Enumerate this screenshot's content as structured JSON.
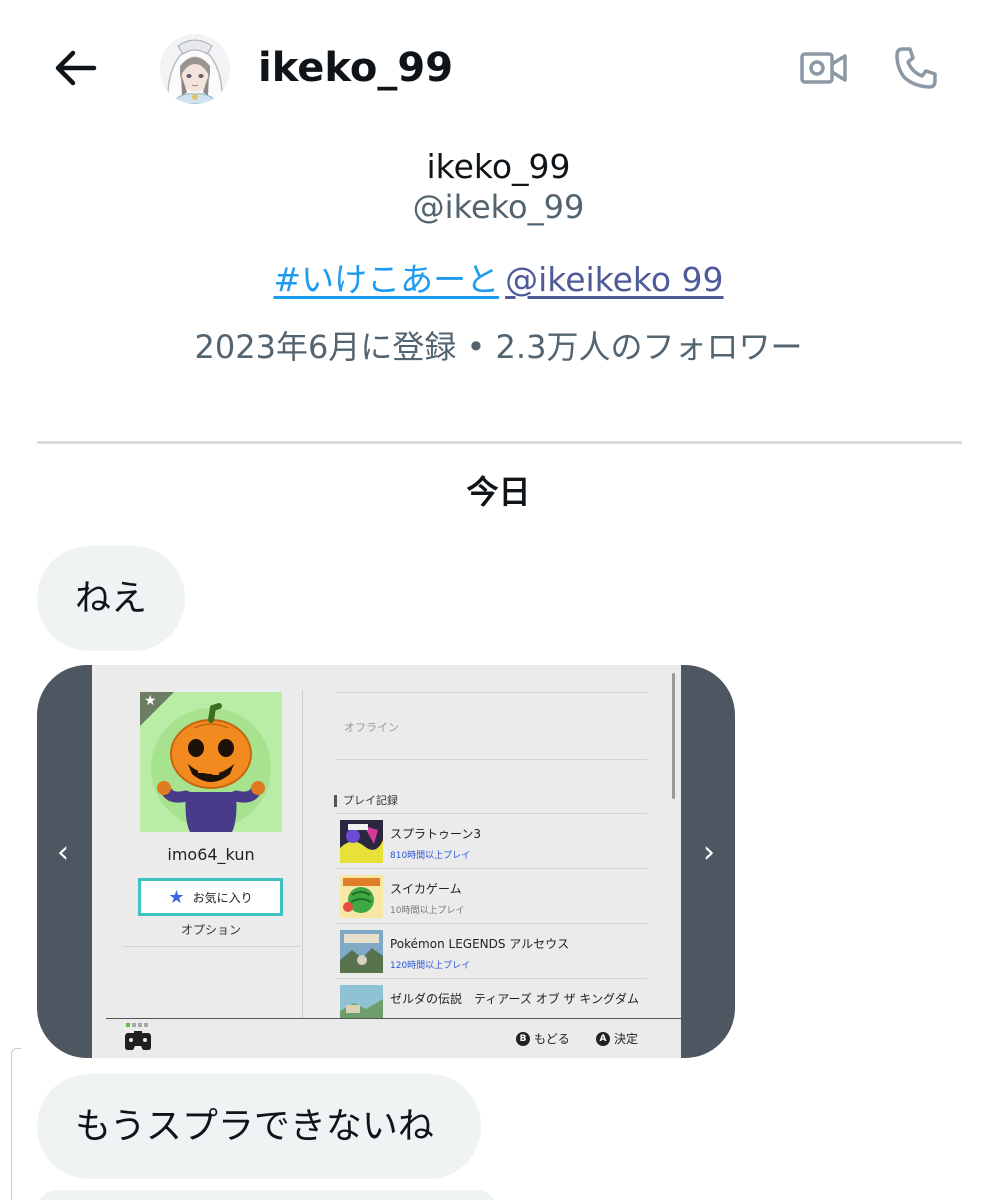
{
  "header": {
    "display_name": "ikeko_99",
    "back_icon": "arrow-left-icon",
    "video_call_icon": "video-camera-icon",
    "voice_call_icon": "phone-icon"
  },
  "profile": {
    "name": "ikeko_99",
    "handle": "@ikeko_99",
    "bio_hashtag": "#いけこあーと",
    "bio_mention": "@ikeikeko 99",
    "meta": "2023年6月に登録 • 2.3万人のフォロワー"
  },
  "conversation": {
    "day_label": "今日",
    "messages": [
      {
        "text": "ねえ"
      },
      {
        "text": "もうスプラできないね"
      }
    ]
  },
  "media_card": {
    "username": "imo64_kun",
    "favorite_label": "お気に入り",
    "option_label": "オプション",
    "status": "オフライン",
    "section_title": "プレイ記録",
    "games": [
      {
        "title": "スプラトゥーン3",
        "playtime": "810時間以上プレイ"
      },
      {
        "title": "スイカゲーム",
        "playtime": "10時間以上プレイ"
      },
      {
        "title": "Pokémon LEGENDS アルセウス",
        "playtime": "120時間以上プレイ"
      },
      {
        "title": "ゼルダの伝説　ティアーズ オブ ザ キングダム",
        "playtime": ""
      }
    ],
    "hint_back_button": "B",
    "hint_back_label": "もどる",
    "hint_confirm_button": "A",
    "hint_confirm_label": "決定",
    "prev_glyph": "‹",
    "next_glyph": "›"
  },
  "colors": {
    "link_blue": "#1d9bf0",
    "mention_color": "#4f5a99",
    "secondary_text": "#536471",
    "bubble_bg": "#eff3f4",
    "media_frame": "#4d5661",
    "switch_teal": "#40c3c0"
  }
}
